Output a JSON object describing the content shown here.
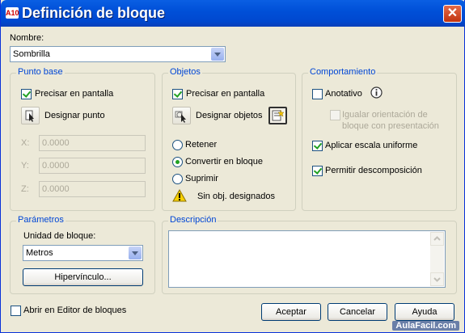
{
  "window": {
    "title": "Definición de bloque",
    "app_icon_text": "A10",
    "close_symbol": "✕"
  },
  "name": {
    "label": "Nombre:",
    "value": "Sombrilla"
  },
  "punto_base": {
    "title": "Punto base",
    "precisar_label": "Precisar en pantalla",
    "precisar_checked": true,
    "designar_label": "Designar punto",
    "x_label": "X:",
    "x_value": "0.0000",
    "y_label": "Y:",
    "y_value": "0.0000",
    "z_label": "Z:",
    "z_value": "0.0000"
  },
  "objetos": {
    "title": "Objetos",
    "precisar_label": "Precisar en pantalla",
    "precisar_checked": true,
    "designar_label": "Designar objetos",
    "retener_label": "Retener",
    "convertir_label": "Convertir en bloque",
    "suprimir_label": "Suprimir",
    "selected_option": "convertir",
    "warning_text": "Sin obj. designados"
  },
  "comportamiento": {
    "title": "Comportamiento",
    "anotativo_label": "Anotativo",
    "anotativo_checked": false,
    "igualar_label_line1": "Igualar orientación de",
    "igualar_label_line2": "bloque con presentación",
    "igualar_checked": false,
    "escala_label": "Aplicar escala uniforme",
    "escala_checked": true,
    "descomposicion_label": "Permitir descomposición",
    "descomposicion_checked": true
  },
  "parametros": {
    "title": "Parámetros",
    "unidad_label": "Unidad de bloque:",
    "unidad_value": "Metros",
    "hipervinculo_label": "Hipervínculo..."
  },
  "descripcion": {
    "title": "Descripción",
    "value": ""
  },
  "footer": {
    "abrir_editor_label": "Abrir en Editor de bloques",
    "abrir_editor_checked": false,
    "aceptar_label": "Aceptar",
    "cancelar_label": "Cancelar",
    "ayuda_label": "Ayuda"
  },
  "watermark": "AulaFacil.com",
  "colors": {
    "titlebar": "#0054E3",
    "group_label": "#0046D5",
    "dialog_bg": "#ECE9D8",
    "check_mark": "#21A121",
    "close_button": "#D8461F"
  },
  "icons": {
    "info": "info-icon",
    "warning": "warning-icon",
    "pick_point": "pick-point-icon",
    "select_objects": "select-objects-icon",
    "quick_select": "quick-select-icon"
  }
}
